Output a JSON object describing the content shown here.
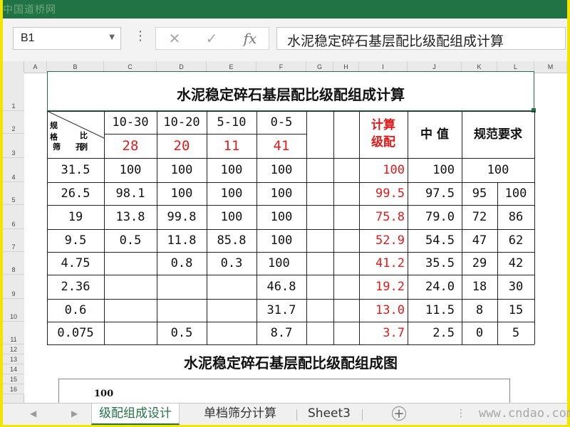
{
  "watermark_top": "中国道桥网",
  "formula_bar": {
    "name_box": "B1",
    "cancel_icon": "close-icon",
    "enter_icon": "check-icon",
    "fx_label": "fx",
    "formula": "水泥稳定碎石基层配比级配组成计算"
  },
  "columns": [
    "A",
    "B",
    "C",
    "D",
    "E",
    "F",
    "G",
    "H",
    "I",
    "J",
    "K",
    "L",
    "M"
  ],
  "rows": [
    "1",
    "2",
    "3",
    "4",
    "5",
    "6",
    "7",
    "8",
    "9",
    "10",
    "11",
    "12",
    "13",
    "14",
    "15",
    "16"
  ],
  "table": {
    "title": "水泥稳定碎石基层配比级配组成计算",
    "corner": {
      "top_left": "规格",
      "top_right": "比例",
      "bottom_left": "筛",
      "bottom_mid": "孔"
    },
    "sizes": [
      "10-30",
      "10-20",
      "5-10",
      "0-5"
    ],
    "ratios": [
      "28",
      "20",
      "11",
      "41"
    ],
    "calc_header": "计算\n级配",
    "mid_header": "中 值",
    "spec_header": "规范要求",
    "data_rows": [
      {
        "sieve": "31.5",
        "c": "100",
        "d": "100",
        "e": "100",
        "f": "100",
        "calc": "100",
        "mid": "100",
        "spec_lo": "100",
        "spec_hi": ""
      },
      {
        "sieve": "26.5",
        "c": "98.1",
        "d": "100",
        "e": "100",
        "f": "100",
        "calc": "99.5",
        "mid": "97.5",
        "spec_lo": "95",
        "spec_hi": "100"
      },
      {
        "sieve": "19",
        "c": "13.8",
        "d": "99.8",
        "e": "100",
        "f": "100",
        "calc": "75.8",
        "mid": "79.0",
        "spec_lo": "72",
        "spec_hi": "86"
      },
      {
        "sieve": "9.5",
        "c": "0.5",
        "d": "11.8",
        "e": "85.8",
        "f": "100",
        "calc": "52.9",
        "mid": "54.5",
        "spec_lo": "47",
        "spec_hi": "62"
      },
      {
        "sieve": "4.75",
        "c": "",
        "d": "0.8",
        "e": "0.3",
        "f": "100",
        "calc": "41.2",
        "mid": "35.5",
        "spec_lo": "29",
        "spec_hi": "42"
      },
      {
        "sieve": "2.36",
        "c": "",
        "d": "",
        "e": "",
        "f": "46.8",
        "calc": "19.2",
        "mid": "24.0",
        "spec_lo": "18",
        "spec_hi": "30"
      },
      {
        "sieve": "0.6",
        "c": "",
        "d": "",
        "e": "",
        "f": "31.7",
        "calc": "13.0",
        "mid": "11.5",
        "spec_lo": "8",
        "spec_hi": "15"
      },
      {
        "sieve": "0.075",
        "c": "",
        "d": "0.5",
        "e": "",
        "f": "8.7",
        "calc": "3.7",
        "mid": "2.5",
        "spec_lo": "0",
        "spec_hi": "5"
      }
    ]
  },
  "chart": {
    "title": "水泥稳定碎石基层配比级配组成图",
    "y_tick_top": "100"
  },
  "tabs": [
    "级配组成设计",
    "单档筛分计算",
    "Sheet3"
  ],
  "active_tab": "级配组成设计",
  "watermark_bottom": "www.cndao.com",
  "colors": {
    "excel_green": "#217346",
    "red_value": "#e41a1a",
    "frame_yellow": "#f2e600"
  }
}
